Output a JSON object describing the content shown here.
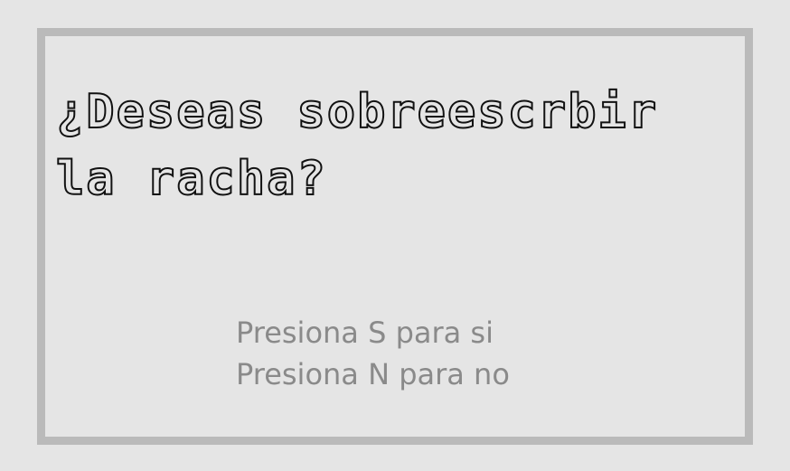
{
  "dialog": {
    "question_line1": "¿Deseas sobreescrbir",
    "question_line2": "la racha?",
    "option_yes": "Presiona S para si",
    "option_no": "Presiona N para no"
  },
  "colors": {
    "background": "#e5e5e5",
    "border": "#bababa",
    "title_outline": "#111111",
    "instruction_text": "#8a8a8a"
  }
}
